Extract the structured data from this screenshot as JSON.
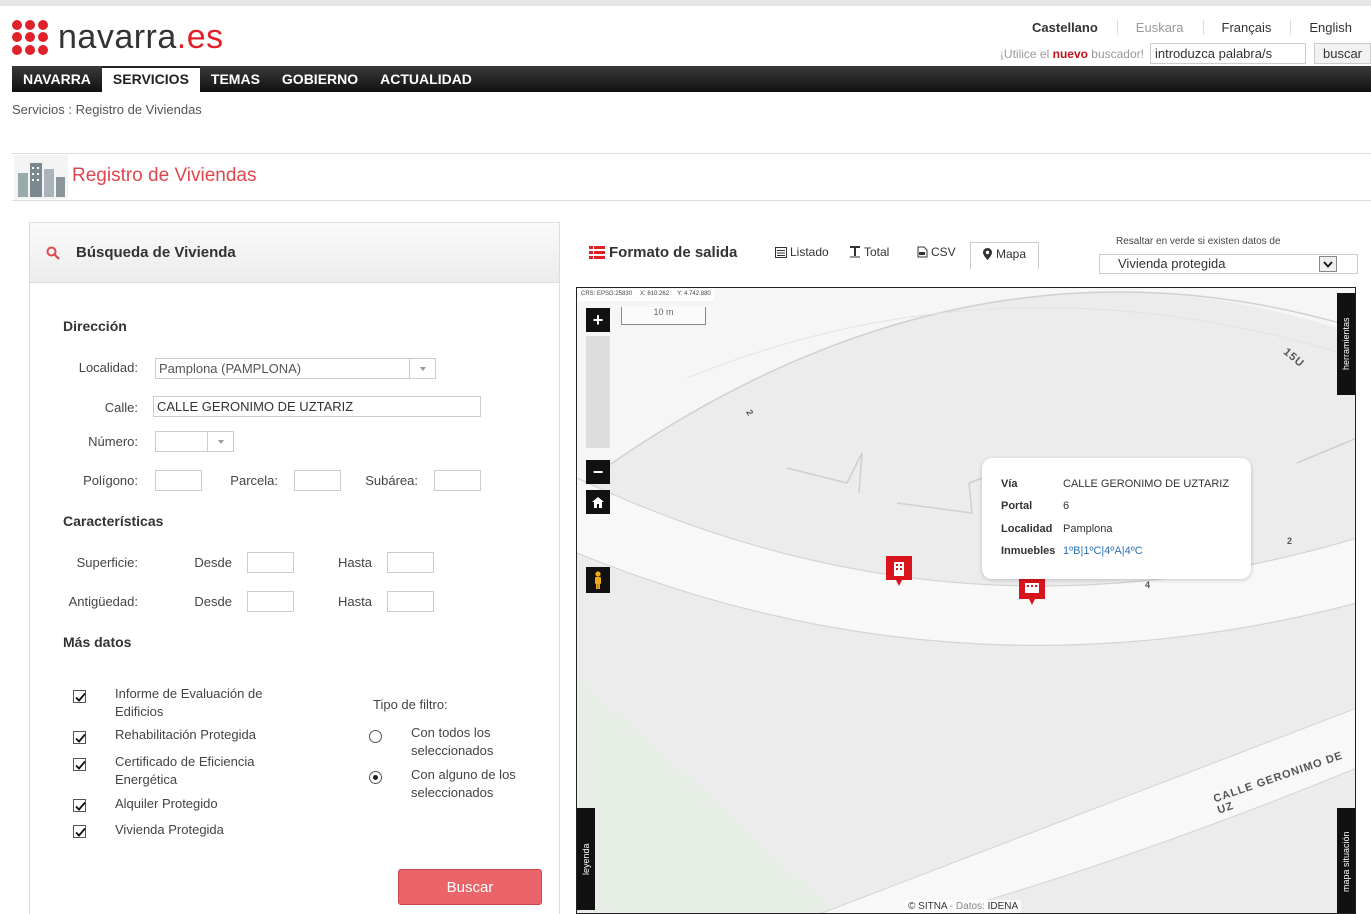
{
  "header": {
    "logo_text": "navarra",
    "logo_suffix": ".es",
    "languages": [
      "Castellano",
      "Euskara",
      "Français",
      "English"
    ],
    "search_prompt_pre": "¡Utilice el ",
    "search_prompt_bold": "nuevo",
    "search_prompt_post": " buscador!",
    "search_value": "introduzca palabra/s",
    "search_button": "buscar"
  },
  "nav": {
    "items": [
      "NAVARRA",
      "SERVICIOS",
      "TEMAS",
      "GOBIERNO",
      "ACTUALIDAD"
    ],
    "active": "SERVICIOS"
  },
  "breadcrumb": "Servicios :  Registro de Viviendas",
  "page": {
    "title": "Registro de Viviendas"
  },
  "search_panel": {
    "title": "Búsqueda de Vivienda",
    "direccion": "Dirección",
    "localidad_label": "Localidad:",
    "localidad_value": "Pamplona (PAMPLONA)",
    "calle_label": "Calle:",
    "calle_value": "CALLE GERONIMO DE UZTARIZ",
    "numero_label": "Número:",
    "poligono_label": "Polígono:",
    "parcela_label": "Parcela:",
    "subarea_label": "Subárea:",
    "caracteristicas": "Características",
    "superficie_label": "Superficie:",
    "antiguedad_label": "Antigüedad:",
    "desde": "Desde",
    "hasta": "Hasta",
    "mas_datos": "Más datos",
    "checkboxes": [
      {
        "line1": "Informe de Evaluación de",
        "line2": "Edificios",
        "checked": true
      },
      {
        "line1": "Rehabilitación Protegida",
        "line2": "",
        "checked": true
      },
      {
        "line1": "Certificado de Eficiencia",
        "line2": "Energética",
        "checked": true
      },
      {
        "line1": "Alquiler Protegido",
        "line2": "",
        "checked": true
      },
      {
        "line1": "Vivienda Protegida",
        "line2": "",
        "checked": true
      }
    ],
    "filtro_label": "Tipo de filtro:",
    "radios": [
      {
        "line1": "Con todos los",
        "line2": "seleccionados",
        "selected": false
      },
      {
        "line1": "Con alguno de los",
        "line2": "seleccionados",
        "selected": true
      }
    ],
    "submit": "Buscar"
  },
  "output": {
    "title": "Formato de salida",
    "tabs": [
      "Listado",
      "Total",
      "CSV",
      "Mapa"
    ],
    "active_tab": "Mapa",
    "highlight_label": "Resaltar en verde si existen datos de",
    "highlight_value": "Vivienda protegida"
  },
  "map": {
    "crs": "CRS: EPSG:25830",
    "x": "X: 610.262",
    "y": "Y: 4.742.880",
    "scale": "10 m",
    "tab_herramientas": "herramientas",
    "tab_leyenda": "leyenda",
    "tab_situacion": "mapa situación",
    "street_label": "CALLE GERONIMO DE UZ",
    "house_numbers": [
      "2",
      "15U",
      "2",
      "4"
    ],
    "popup": {
      "via_label": "Vía",
      "via_value": "CALLE GERONIMO DE UZTARIZ",
      "portal_label": "Portal",
      "portal_value": "6",
      "localidad_label": "Localidad",
      "localidad_value": "Pamplona",
      "inmuebles_label": "Inmuebles",
      "inmuebles_value": "1ºB|1ºC|4ºA|4ºC"
    },
    "attribution_brand": "© SITNA",
    "attribution_mid": " - Datos: ",
    "attribution_src": "IDENA"
  },
  "colors": {
    "brand_red": "#e0212a",
    "title_red": "#e0464e",
    "button_red": "#ea6469",
    "link_blue": "#2f6fb8"
  }
}
